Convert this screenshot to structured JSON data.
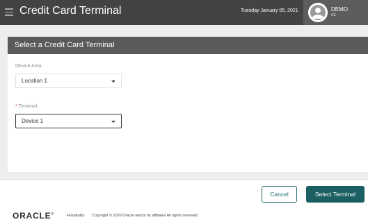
{
  "header": {
    "title": "Credit Card Terminal",
    "date": "Tuesday January 05, 2021",
    "user": {
      "name": "DEMO",
      "sub": "#1"
    },
    "icons": {
      "menu": "hamburger-menu-icon",
      "avatar": "user-avatar-icon"
    }
  },
  "panel": {
    "title": "Select a Credit Card Terminal",
    "device_area": {
      "label": "Device Area",
      "value": "Location 1"
    },
    "terminal": {
      "required_mark": "*",
      "label": "Terminal",
      "value": "Device 1"
    }
  },
  "actions": {
    "cancel": "Cancel",
    "select": "Select Terminal"
  },
  "footer": {
    "logo": "ORACLE",
    "trademark": "®",
    "hospitality": "Hospitality",
    "copyright": "Copyright © 2020 Oracle and/or its affiliates All rights reserved."
  },
  "colors": {
    "topbar": "#434343",
    "panel_header": "#5a5a5a",
    "accent": "#1b5f63",
    "required": "#c74634"
  }
}
